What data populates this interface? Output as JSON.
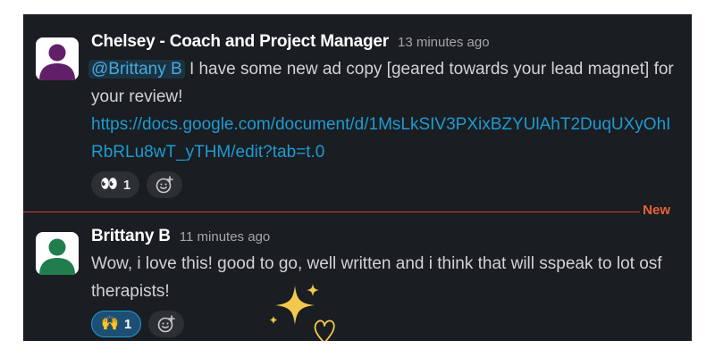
{
  "messages": [
    {
      "author": "Chelsey - Coach and Project Manager",
      "time": "13 minutes ago",
      "mention": "@Brittany B",
      "text": "I have some new ad copy [geared towards your lead magnet] for your review!",
      "link": "https://docs.google.com/document/d/1MsLkSIV3PXixBZYUlAhT2DuqUXyOhIRbRLu8wT_yTHM/edit?tab=t.0",
      "avatar_color": "#611f69",
      "reactions": [
        {
          "emoji": "👀",
          "emoji_name": "eyes",
          "count": "1",
          "mine": false
        }
      ]
    },
    {
      "author": "Brittany B",
      "time": "11 minutes ago",
      "text": "Wow, i love this! good to go, well written and i think that will sspeak to lot osf therapists!",
      "avatar_color": "#1f7d4e",
      "reactions": [
        {
          "emoji": "🙌",
          "emoji_name": "raised-hands",
          "count": "1",
          "mine": true
        }
      ]
    }
  ],
  "divider": {
    "label": "New",
    "color": "#cd3b2c"
  },
  "add_reaction_icon": "add-reaction-icon",
  "colors": {
    "background": "#1a1d21",
    "link": "#1d9bd1",
    "sparkle": "#f2c94c"
  }
}
